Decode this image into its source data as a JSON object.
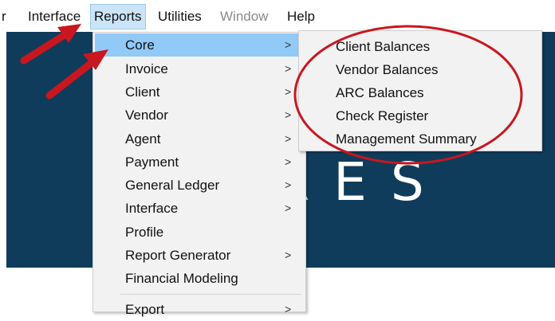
{
  "menubar": {
    "items": [
      {
        "label": "r"
      },
      {
        "label": "Interface"
      },
      {
        "label": "Reports"
      },
      {
        "label": "Utilities"
      },
      {
        "label": "Window"
      },
      {
        "label": "Help"
      }
    ]
  },
  "banner": {
    "text": "TRES"
  },
  "reports_menu": {
    "items": [
      {
        "label": "Core",
        "submenu_arrow": ">"
      },
      {
        "label": "Invoice",
        "submenu_arrow": ">"
      },
      {
        "label": "Client",
        "submenu_arrow": ">"
      },
      {
        "label": "Vendor",
        "submenu_arrow": ">"
      },
      {
        "label": "Agent",
        "submenu_arrow": ">"
      },
      {
        "label": "Payment",
        "submenu_arrow": ">"
      },
      {
        "label": "General Ledger",
        "submenu_arrow": ">"
      },
      {
        "label": "Interface",
        "submenu_arrow": ">"
      },
      {
        "label": "Profile",
        "submenu_arrow": ""
      },
      {
        "label": "Report Generator",
        "submenu_arrow": ">"
      },
      {
        "label": "Financial Modeling",
        "submenu_arrow": ""
      },
      {
        "label": "Export",
        "submenu_arrow": ">"
      }
    ]
  },
  "core_submenu": {
    "items": [
      {
        "label": "Client Balances"
      },
      {
        "label": "Vendor Balances"
      },
      {
        "label": "ARC Balances"
      },
      {
        "label": "Check Register"
      },
      {
        "label": "Management Summary"
      }
    ]
  },
  "colors": {
    "banner": "#103c5c",
    "highlight": "#91c9f7",
    "annotation": "#c8171e"
  },
  "annotations": {
    "arrow_icon": "red-arrow-icon",
    "circle_icon": "red-circle-icon"
  }
}
